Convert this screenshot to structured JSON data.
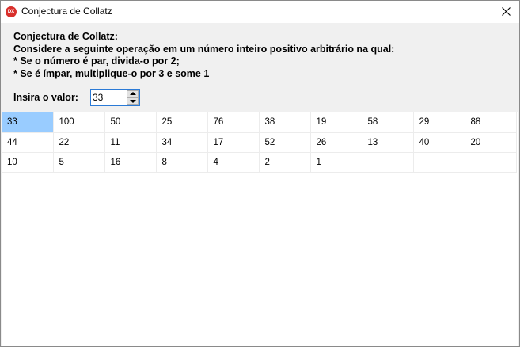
{
  "window": {
    "title": "Conjectura de Collatz",
    "icon_text": "DX",
    "icon_name": "app-icon",
    "close_icon": "close-icon"
  },
  "description": {
    "heading": "Conjectura de Collatz:",
    "line1": "Considere a seguinte operação em um número inteiro positivo arbitrário na qual:",
    "line2": "* Se o número é par, divida-o por 2;",
    "line3": "* Se é ímpar, multiplique-o por 3 e some 1"
  },
  "input": {
    "label": "Insira o valor:",
    "value": "33"
  },
  "grid": {
    "selected_cell": "33",
    "selection_color": "#99ccff",
    "rows": [
      [
        "33",
        "100",
        "50",
        "25",
        "76",
        "38",
        "19",
        "58",
        "29",
        "88"
      ],
      [
        "44",
        "22",
        "11",
        "34",
        "17",
        "52",
        "26",
        "13",
        "40",
        "20"
      ],
      [
        "10",
        "5",
        "16",
        "8",
        "4",
        "2",
        "1",
        "",
        "",
        ""
      ]
    ]
  }
}
